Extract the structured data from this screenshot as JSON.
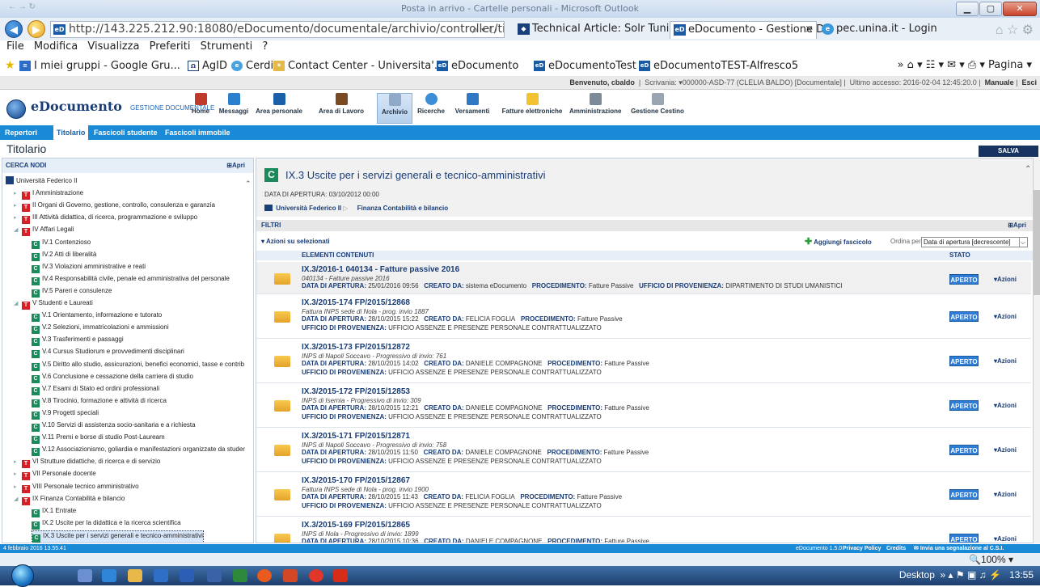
{
  "window": {
    "title": "Posta in arrivo - Cartelle personali - Microsoft Outlook",
    "quick_access": "← → ↻"
  },
  "browser": {
    "url": "http://143.225.212.90:18080/eDocumento/documentale/archivio/controller/titolariofascicoliList",
    "url_icons": "⌕ ▾ ↻",
    "tabs": [
      {
        "label": "Technical Article: Solr Tuning..."
      },
      {
        "label": "eDocumento - Gestione D...",
        "close": "×"
      },
      {
        "label": "pec.unina.it - Login"
      }
    ],
    "right_icons": "⌂ ☆ ⚙"
  },
  "menu": [
    "File",
    "Modifica",
    "Visualizza",
    "Preferiti",
    "Strumenti",
    "?"
  ],
  "favorites": [
    "I miei gruppi - Google Gru...",
    "AgID",
    "Cerdi",
    "Contact Center - Universita'...",
    "eDocumento",
    "eDocumentoTest",
    "eDocumentoTEST-Alfresco5"
  ],
  "favorites_right": "»   ⌂ ▾  ☷ ▾  ✉ ▾  ⎙ ▾  Pagina ▾",
  "userbar": {
    "welcome": "Benvenuto, cbaldo",
    "scrivania": "Scrivania: ▾000000-ASD-77 (CLELIA BALDO) [Documentale]",
    "last_access": "Ultimo accesso: 2016-02-04 12:45:20.0",
    "manuale": "Manuale",
    "esci": "Esci"
  },
  "app": {
    "name": "eDocumento",
    "subtitle": "GESTIONE DOCUMENTALE"
  },
  "toolbar": [
    "Home",
    "Messaggi",
    "Area personale",
    "Area di Lavoro",
    "Archivio",
    "Ricerche",
    "Versamenti",
    "Fatture elettroniche",
    "Amministrazione",
    "Gestione Cestino"
  ],
  "subnav": [
    "Repertori",
    "Titolario",
    "Fascicoli studente",
    "Fascicoli immobile"
  ],
  "page_title": "Titolario",
  "salva": "SALVA IMPOSTAZIONI",
  "left": {
    "header": "CERCA NODI",
    "apri": "Apri",
    "tree": [
      {
        "label": "Università Federico II",
        "type": "U",
        "level": 0,
        "exp": ""
      },
      {
        "label": "I Amministrazione",
        "type": "T",
        "level": 1,
        "exp": "▸"
      },
      {
        "label": "II Organi di Governo, gestione, controllo, consulenza e garanzia",
        "type": "T",
        "level": 1,
        "exp": "▸"
      },
      {
        "label": "III Attività didattica, di ricerca, programmazione e sviluppo",
        "type": "T",
        "level": 1,
        "exp": "▸"
      },
      {
        "label": "IV Affari Legali",
        "type": "T",
        "level": 1,
        "exp": "◢"
      },
      {
        "label": "IV.1 Contenzioso",
        "type": "C",
        "level": 2,
        "exp": ""
      },
      {
        "label": "IV.2 Atti di liberalità",
        "type": "C",
        "level": 2,
        "exp": ""
      },
      {
        "label": "IV.3 Violazioni amministrative e reati",
        "type": "C",
        "level": 2,
        "exp": ""
      },
      {
        "label": "IV.4 Responsabilità civile, penale ed amministrativa del personale",
        "type": "C",
        "level": 2,
        "exp": ""
      },
      {
        "label": "IV.5 Pareri e consulenze",
        "type": "C",
        "level": 2,
        "exp": ""
      },
      {
        "label": "V Studenti e Laureati",
        "type": "T",
        "level": 1,
        "exp": "◢"
      },
      {
        "label": "V.1 Orientamento, informazione e tutorato",
        "type": "C",
        "level": 2,
        "exp": ""
      },
      {
        "label": "V.2 Selezioni, immatricolazioni e ammissioni",
        "type": "C",
        "level": 2,
        "exp": ""
      },
      {
        "label": "V.3 Trasferimenti e passaggi",
        "type": "C",
        "level": 2,
        "exp": ""
      },
      {
        "label": "V.4 Cursus Studiorum e provvedimenti disciplinari",
        "type": "C",
        "level": 2,
        "exp": ""
      },
      {
        "label": "V.5 Diritto allo studio, assicurazioni, benefici economici, tasse e contrib",
        "type": "C",
        "level": 2,
        "exp": ""
      },
      {
        "label": "V.6 Conclusione e cessazione della carriera di studio",
        "type": "C",
        "level": 2,
        "exp": ""
      },
      {
        "label": "V.7 Esami di Stato ed ordini professionali",
        "type": "C",
        "level": 2,
        "exp": ""
      },
      {
        "label": "V.8 Tirocinio, formazione e attività di ricerca",
        "type": "C",
        "level": 2,
        "exp": ""
      },
      {
        "label": "V.9 Progetti speciali",
        "type": "C",
        "level": 2,
        "exp": ""
      },
      {
        "label": "V.10 Servizi di assistenza socio-sanitaria e a richiesta",
        "type": "C",
        "level": 2,
        "exp": ""
      },
      {
        "label": "V.11 Premi e borse di studio Post-Lauream",
        "type": "C",
        "level": 2,
        "exp": ""
      },
      {
        "label": "V.12 Associazionismo, goliardia e manifestazioni organizzate da studer",
        "type": "C",
        "level": 2,
        "exp": ""
      },
      {
        "label": "VI Strutture didattiche, di ricerca e di servizio",
        "type": "T",
        "level": 1,
        "exp": "▸"
      },
      {
        "label": "VII Personale docente",
        "type": "T",
        "level": 1,
        "exp": "▸"
      },
      {
        "label": "VIII Personale tecnico amministrativo",
        "type": "T",
        "level": 1,
        "exp": "▸"
      },
      {
        "label": "IX Finanza Contabilità e bilancio",
        "type": "T",
        "level": 1,
        "exp": "◢"
      },
      {
        "label": "IX.1 Entrate",
        "type": "C",
        "level": 2,
        "exp": ""
      },
      {
        "label": "IX.2 Uscite per la didattica e la ricerca scientifica",
        "type": "C",
        "level": 2,
        "exp": ""
      },
      {
        "label": "IX.3 Uscite per i servizi generali e tecnico-amministrativi",
        "type": "C",
        "level": 2,
        "exp": "",
        "selected": true
      },
      {
        "label": "IX.4 Rendicontazioni",
        "type": "C",
        "level": 2,
        "exp": ""
      }
    ]
  },
  "detail": {
    "title": "IX.3 Uscite per i servizi generali e tecnico-amministrativi",
    "data_apertura": "DATA DI APERTURA: 03/10/2012 00:00",
    "breadcrumb": [
      "Università Federico II",
      "Finanza Contabilità e bilancio"
    ],
    "filtri": "FILTRI",
    "apri": "Apri",
    "azioni_sel": "▾ Azioni su selezionati",
    "aggiungi": "Aggiungi fascicolo",
    "ordina_label": "Ordina per",
    "ordina_value": "Data di apertura [decrescente]",
    "col_elementi": "ELEMENTI CONTENUTI",
    "col_stato": "STATO",
    "rows": [
      {
        "code": "IX.3/2016-1  040134 - Fatture passive 2016",
        "desc": "040134 - Fatture passive 2016",
        "data": "25/01/2016 09:56",
        "creato": "sistema eDocumento",
        "proc": "Fatture Passive",
        "ufficio": "DIPARTIMENTO DI STUDI UMANISTICI",
        "stato": "APERTO",
        "azioni": "▾Azioni"
      },
      {
        "code": "IX.3/2015-174  FP/2015/12868",
        "desc": "Fattura INPS sede di Nola - prog. invio 1887",
        "data": "28/10/2015 15:22",
        "creato": "FELICIA FOGLIA",
        "proc": "Fatture Passive",
        "ufficio": "UFFICIO ASSENZE E PRESENZE PERSONALE CONTRATTUALIZZATO",
        "stato": "APERTO",
        "azioni": "▾Azioni"
      },
      {
        "code": "IX.3/2015-173  FP/2015/12872",
        "desc": "INPS di Napoli Soccavo - Progressivo di invio: 761",
        "data": "28/10/2015 14:02",
        "creato": "DANIELE COMPAGNONE",
        "proc": "Fatture Passive",
        "ufficio": "UFFICIO ASSENZE E PRESENZE PERSONALE CONTRATTUALIZZATO",
        "stato": "APERTO",
        "azioni": "▾Azioni"
      },
      {
        "code": "IX.3/2015-172  FP/2015/12853",
        "desc": "INPS di Isernia - Progressivo di invio: 309",
        "data": "28/10/2015 12:21",
        "creato": "DANIELE COMPAGNONE",
        "proc": "Fatture Passive",
        "ufficio": "UFFICIO ASSENZE E PRESENZE PERSONALE CONTRATTUALIZZATO",
        "stato": "APERTO",
        "azioni": "▾Azioni"
      },
      {
        "code": "IX.3/2015-171  FP/2015/12871",
        "desc": "INPS di Napoli Soccavo - Progressivo di invio: 758",
        "data": "28/10/2015 11:50",
        "creato": "DANIELE COMPAGNONE",
        "proc": "Fatture Passive",
        "ufficio": "UFFICIO ASSENZE E PRESENZE PERSONALE CONTRATTUALIZZATO",
        "stato": "APERTO",
        "azioni": "▾Azioni"
      },
      {
        "code": "IX.3/2015-170  FP/2015/12867",
        "desc": "Fattura INPS sede di Nola - prog. invio 1900",
        "data": "28/10/2015 11:43",
        "creato": "FELICIA FOGLIA",
        "proc": "Fatture Passive",
        "ufficio": "UFFICIO ASSENZE E PRESENZE PERSONALE CONTRATTUALIZZATO",
        "stato": "APERTO",
        "azioni": "▾Azioni"
      },
      {
        "code": "IX.3/2015-169  FP/2015/12865",
        "desc": "INPS di Nola - Progressivo di invio: 1899",
        "data": "28/10/2015 10:36",
        "creato": "DANIELE COMPAGNONE",
        "proc": "Fatture Passive",
        "ufficio": "",
        "stato": "APERTO",
        "azioni": "▾Azioni"
      }
    ],
    "labels": {
      "data": "DATA DI APERTURA:",
      "creato": "CREATO DA:",
      "proc": "PROCEDIMENTO:",
      "ufficio": "UFFICIO DI PROVENIENZA:"
    }
  },
  "footer": {
    "date": "4 febbraio 2016 13.55.41",
    "version": "eDocumento 1.5.0",
    "privacy": "Privacy Policy",
    "credits": "Credits",
    "segnala": "Invia una segnalazione al C.S.I."
  },
  "status": {
    "zoom": "100%",
    "zoom_icon": "🔍"
  },
  "taskbar": {
    "desktop": "Desktop",
    "time": "13:55",
    "tray_icons": "»  ▴  ⚑  ▣  ♫  ⚡"
  },
  "colors": {
    "blue_nav": "#1a8ad6",
    "aperto": "#2e7cd6",
    "titolo": "#d62028",
    "classe": "#1a8a5a"
  }
}
